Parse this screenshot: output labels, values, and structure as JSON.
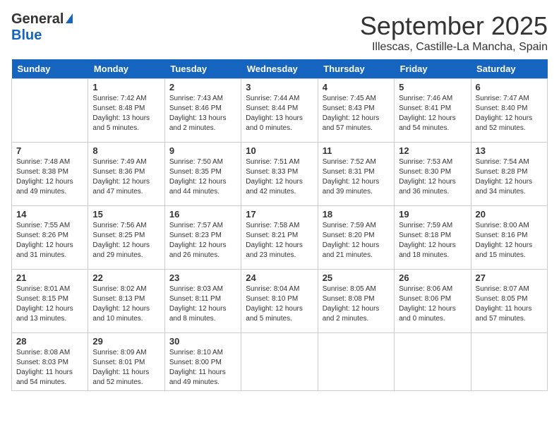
{
  "logo": {
    "general": "General",
    "blue": "Blue"
  },
  "title": "September 2025",
  "location": "Illescas, Castille-La Mancha, Spain",
  "days_of_week": [
    "Sunday",
    "Monday",
    "Tuesday",
    "Wednesday",
    "Thursday",
    "Friday",
    "Saturday"
  ],
  "weeks": [
    [
      {
        "num": "",
        "info": ""
      },
      {
        "num": "1",
        "info": "Sunrise: 7:42 AM\nSunset: 8:48 PM\nDaylight: 13 hours\nand 5 minutes."
      },
      {
        "num": "2",
        "info": "Sunrise: 7:43 AM\nSunset: 8:46 PM\nDaylight: 13 hours\nand 2 minutes."
      },
      {
        "num": "3",
        "info": "Sunrise: 7:44 AM\nSunset: 8:44 PM\nDaylight: 13 hours\nand 0 minutes."
      },
      {
        "num": "4",
        "info": "Sunrise: 7:45 AM\nSunset: 8:43 PM\nDaylight: 12 hours\nand 57 minutes."
      },
      {
        "num": "5",
        "info": "Sunrise: 7:46 AM\nSunset: 8:41 PM\nDaylight: 12 hours\nand 54 minutes."
      },
      {
        "num": "6",
        "info": "Sunrise: 7:47 AM\nSunset: 8:40 PM\nDaylight: 12 hours\nand 52 minutes."
      }
    ],
    [
      {
        "num": "7",
        "info": "Sunrise: 7:48 AM\nSunset: 8:38 PM\nDaylight: 12 hours\nand 49 minutes."
      },
      {
        "num": "8",
        "info": "Sunrise: 7:49 AM\nSunset: 8:36 PM\nDaylight: 12 hours\nand 47 minutes."
      },
      {
        "num": "9",
        "info": "Sunrise: 7:50 AM\nSunset: 8:35 PM\nDaylight: 12 hours\nand 44 minutes."
      },
      {
        "num": "10",
        "info": "Sunrise: 7:51 AM\nSunset: 8:33 PM\nDaylight: 12 hours\nand 42 minutes."
      },
      {
        "num": "11",
        "info": "Sunrise: 7:52 AM\nSunset: 8:31 PM\nDaylight: 12 hours\nand 39 minutes."
      },
      {
        "num": "12",
        "info": "Sunrise: 7:53 AM\nSunset: 8:30 PM\nDaylight: 12 hours\nand 36 minutes."
      },
      {
        "num": "13",
        "info": "Sunrise: 7:54 AM\nSunset: 8:28 PM\nDaylight: 12 hours\nand 34 minutes."
      }
    ],
    [
      {
        "num": "14",
        "info": "Sunrise: 7:55 AM\nSunset: 8:26 PM\nDaylight: 12 hours\nand 31 minutes."
      },
      {
        "num": "15",
        "info": "Sunrise: 7:56 AM\nSunset: 8:25 PM\nDaylight: 12 hours\nand 29 minutes."
      },
      {
        "num": "16",
        "info": "Sunrise: 7:57 AM\nSunset: 8:23 PM\nDaylight: 12 hours\nand 26 minutes."
      },
      {
        "num": "17",
        "info": "Sunrise: 7:58 AM\nSunset: 8:21 PM\nDaylight: 12 hours\nand 23 minutes."
      },
      {
        "num": "18",
        "info": "Sunrise: 7:59 AM\nSunset: 8:20 PM\nDaylight: 12 hours\nand 21 minutes."
      },
      {
        "num": "19",
        "info": "Sunrise: 7:59 AM\nSunset: 8:18 PM\nDaylight: 12 hours\nand 18 minutes."
      },
      {
        "num": "20",
        "info": "Sunrise: 8:00 AM\nSunset: 8:16 PM\nDaylight: 12 hours\nand 15 minutes."
      }
    ],
    [
      {
        "num": "21",
        "info": "Sunrise: 8:01 AM\nSunset: 8:15 PM\nDaylight: 12 hours\nand 13 minutes."
      },
      {
        "num": "22",
        "info": "Sunrise: 8:02 AM\nSunset: 8:13 PM\nDaylight: 12 hours\nand 10 minutes."
      },
      {
        "num": "23",
        "info": "Sunrise: 8:03 AM\nSunset: 8:11 PM\nDaylight: 12 hours\nand 8 minutes."
      },
      {
        "num": "24",
        "info": "Sunrise: 8:04 AM\nSunset: 8:10 PM\nDaylight: 12 hours\nand 5 minutes."
      },
      {
        "num": "25",
        "info": "Sunrise: 8:05 AM\nSunset: 8:08 PM\nDaylight: 12 hours\nand 2 minutes."
      },
      {
        "num": "26",
        "info": "Sunrise: 8:06 AM\nSunset: 8:06 PM\nDaylight: 12 hours\nand 0 minutes."
      },
      {
        "num": "27",
        "info": "Sunrise: 8:07 AM\nSunset: 8:05 PM\nDaylight: 11 hours\nand 57 minutes."
      }
    ],
    [
      {
        "num": "28",
        "info": "Sunrise: 8:08 AM\nSunset: 8:03 PM\nDaylight: 11 hours\nand 54 minutes."
      },
      {
        "num": "29",
        "info": "Sunrise: 8:09 AM\nSunset: 8:01 PM\nDaylight: 11 hours\nand 52 minutes."
      },
      {
        "num": "30",
        "info": "Sunrise: 8:10 AM\nSunset: 8:00 PM\nDaylight: 11 hours\nand 49 minutes."
      },
      {
        "num": "",
        "info": ""
      },
      {
        "num": "",
        "info": ""
      },
      {
        "num": "",
        "info": ""
      },
      {
        "num": "",
        "info": ""
      }
    ]
  ]
}
